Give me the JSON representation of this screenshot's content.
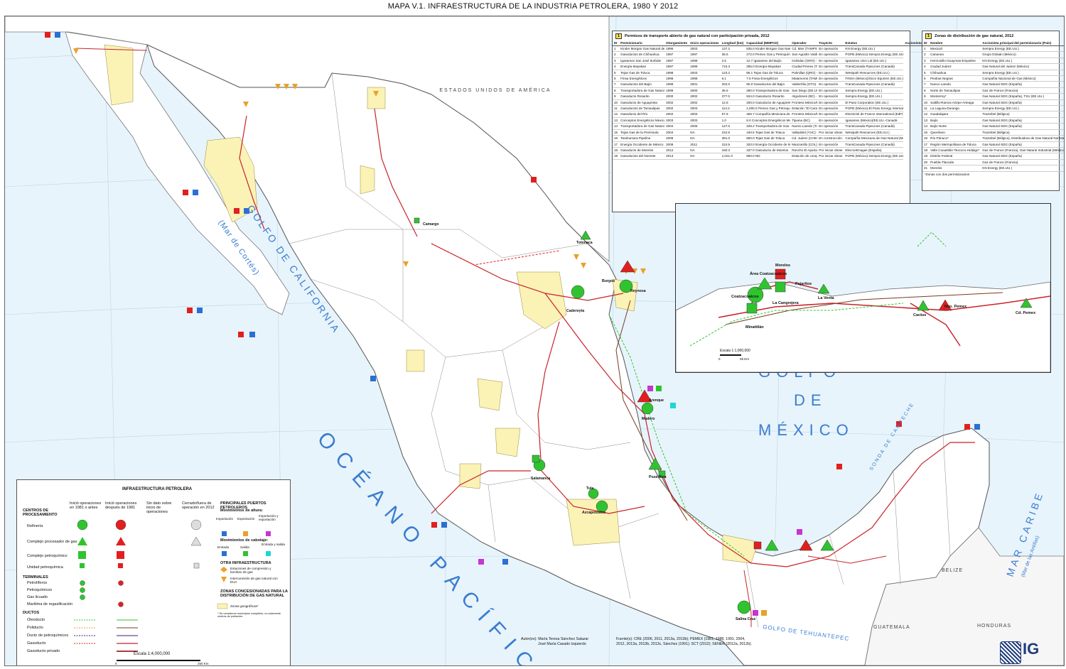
{
  "title": "MAPA V.1. INFRAESTRUCTURA DE LA INDUSTRIA PETROLERA, 1980 Y 2012",
  "labels": {
    "usa": "ESTADOS  UNIDOS  DE  AMÉRICA",
    "golfo_california": "GOLFO DE CALIFORNIA",
    "mar_cortes": "(Mar de Cortés)",
    "golfo_mexico_1": "GOLFO",
    "golfo_mexico_2": "DE",
    "golfo_mexico_3": "MÉXICO",
    "oceano": "OCÉANO PACÍFICO",
    "mar_caribe": "MAR CARIBE",
    "mar_antillas": "(Mar de las Antillas)",
    "belize": "BELIZE",
    "guatemala": "GUATEMALA",
    "honduras": "HONDURAS",
    "tehuantepec": "GOLFO DE TEHUANTEPEC",
    "sonda": "SONDA DE CAMPECHE"
  },
  "cities": [
    {
      "name": "Camargo"
    },
    {
      "name": "Cadereyta"
    },
    {
      "name": "Reynosa"
    },
    {
      "name": "Burgos"
    },
    {
      "name": "Totonaca"
    },
    {
      "name": "Arenque"
    },
    {
      "name": "Madero"
    },
    {
      "name": "Poza Rica"
    },
    {
      "name": "Salamanca"
    },
    {
      "name": "Tula"
    },
    {
      "name": "Azcapotzalco"
    },
    {
      "name": "Salina Cruz"
    }
  ],
  "pipeline_table": {
    "badge": "1",
    "title": "Permisos de transporte abierto de gas natural con participación privada, 2012",
    "headers": [
      "ID",
      "Permisionario",
      "Otorgamiento",
      "Inicio operaciones",
      "Longitud (km)",
      "Capacidad (MMPCD)",
      "Operador",
      "Trayecto",
      "Estatus",
      "Accionista principal (País)"
    ],
    "rows": [
      [
        "1",
        "Kinder Morgan Gas Natural de México",
        "1996",
        "2003",
        "137.2",
        "635.0 Kinder Morgan Gas Natural de México",
        "Cd. Mier (TAMPS) - Monterrey (NL)",
        "En operación",
        "KN Energy (EE.UU.)"
      ],
      [
        "2",
        "Gasoductos de Chihuahua",
        "1997",
        "1997",
        "36.5",
        "272.0 Pemex Gas y Petroquímica Básica",
        "San Agustín Valdivia (Chih) - Samalayuca (Chih)",
        "En operación",
        "PGPB (México)-Sempra Energy (EE.UU.)"
      ],
      [
        "3",
        "Igasamex San José Iturbide",
        "1997",
        "1998",
        "2.5",
        "12.7 Igasamex del Bajío",
        "Irolindan (GRO) - San José Iturbide (GLP)",
        "En operación",
        "Igasamex USA Ltd (EE.UU.)"
      ],
      [
        "4",
        "Energía Mayakan",
        "1997",
        "1999",
        "710.3",
        "285.0 Energía Mayakan",
        "Ciudad Pemex (TAB) - Valladolid (YUC)",
        "En operación",
        "TransCanada PipeLines (Canadá)"
      ],
      [
        "5",
        "Tejas Gas de Toluca",
        "1998",
        "2003",
        "123.2",
        "86.1 Tejas Gas de Toluca",
        "Palmillas (QRO) - Toluca (MEX)",
        "En operación",
        "Westpath Resources (EE.UU.)"
      ],
      [
        "6",
        "Finsa Energéticos",
        "1998",
        "1998",
        "6.1",
        "7.6 Finsa Energéticos",
        "Matamoros (TAMPS)",
        "En operación",
        "FINSA (México)/Sicor EquGen (EE.UU.)"
      ],
      [
        "7",
        "Gasoductos del Bajío",
        "1999",
        "2001",
        "202.0",
        "90.0 Gasoductos del Bajío",
        "Valtierrilla (GTO) - Aguascalientes (AGS)",
        "En operación",
        "TransCanada PipeLines (Canadá)"
      ],
      [
        "8",
        "Transportadora de Gas Natural de Baja California",
        "1999",
        "2000",
        "36.5",
        "280.0 Transportadora de Gas Natural de Baja California",
        "San Diego (EE.UU.) - Rosarito (BC)",
        "En operación",
        "Sempra Energy (EE.UU.)"
      ],
      [
        "9",
        "Gasoducto Rosarito",
        "2000",
        "2002",
        "377.0",
        "534.0 Gasoducto Rosarito",
        "Algodones (BC) - Tijuana (BC)",
        "En operación",
        "Sempra Energy (EE.UU.)"
      ],
      [
        "10",
        "Gasoducto de Aguaprieta",
        "2002",
        "2002",
        "12.5",
        "200.0 Gasoducto de Aguaprieta",
        "Frontera México/Estados Unidos - Naco (SON)",
        "En operación",
        "El Paso Corporation (EE.UU.)"
      ],
      [
        "11",
        "Gasoductos de Tamaulipas",
        "2002",
        "2003",
        "114.2",
        "1,000.0 Pemex Gas y Petroquímica Básica",
        "Estación \"El Caracol\" en Reynosa (TAMPS) - Estación \"Los Indios\" en San Fernando (TAMPS)",
        "En operación",
        "PGPB (México)-El Paso Energy International (EE.UU.)"
      ],
      [
        "12",
        "Gasoducto del Río",
        "2002",
        "2003",
        "57.9",
        "456.7 Compañía Mexicana de Gerencia y Operación",
        "Frontera México/Estados Unidos - CCC Río Bravo II, III y IV y Planta CC (TAMPS)",
        "En operación",
        "Electricité de France International (EdFI) (Francia)"
      ],
      [
        "13",
        "Conceptos Energéticos Mexicanos",
        "2003",
        "2003",
        "1.0",
        "6.0 Conceptos Energéticos Mexicanos",
        "Tijuana (BC)",
        "En operación",
        "Igasamex (México)/EE.UU.-Canadá"
      ],
      [
        "14",
        "Transportadora de Gas Natural de la Huasteca",
        "2004",
        "2006",
        "127.0",
        "349.2 Transportadora de Gas Natural de la Huasteca",
        "Nuevo Laredo (TAMPS) - Tamazunchale (SLP)",
        "En operación",
        "TransCanada PipeLines (Canadá)"
      ],
      [
        "15",
        "Tejas Gas de la Península",
        "2004",
        "NA",
        "234.5",
        "160.5 Tejas Gas de Toluca",
        "Valladolid (YUC) - Nizuc (QROO) y Punta Venado (QROO) y Valladolid (YUC) - Nizuc (QROO)",
        "Por iniciar obras",
        "Westpath Resources (EE.UU.)"
      ],
      [
        "16",
        "Tarahumara Pipeline",
        "2006",
        "NA",
        "381.0",
        "850.0 Tejas Gas de Toluca",
        "Cd. Juárez (CHIH) - Chihuahua (CHIH)",
        "En construcción",
        "Compañía Mexicana de Gas Natural (México)-Energy Transfer Partners (EE.UU.)"
      ],
      [
        "17",
        "Energía Occidente de México",
        "2008",
        "2011",
        "310.5",
        "320.0 Energía Occidente de México",
        "Manzanillo (COL) - Guadalajara (JAL)",
        "En operación",
        "TransCanada PipeLines (Canadá)"
      ],
      [
        "18",
        "Gasoducto de Morelos",
        "2012",
        "NA",
        "160.3",
        "337.0 Gasoducto de Morelos",
        "Rancho El Apartamento en Tlaxco (TLAX) - Huexca (MOR)",
        "Por iniciar obras",
        "ElecnorEnagas (España)"
      ],
      [
        "19",
        "Gasoductos del Noreste",
        "2013",
        "NA",
        "1,021.0",
        "950.0 ND",
        "Estación de compresión Frontera (TAMPS) - Ajalpan El Alto (OTO) - Aguascalientes (AGS)",
        "Por iniciar obras",
        "PGPB (México)-Sempra Energy (EE.UU.)"
      ]
    ]
  },
  "zones_table": {
    "badge": "1",
    "title": "Zonas de distribución de gas natural, 2012",
    "headers": [
      "ID",
      "Nombre",
      "Accionista principal del permisionario (País)"
    ],
    "rows": [
      [
        "1",
        "Mexicali",
        "Sempra Energy (EE.UU.)"
      ],
      [
        "2",
        "Cananea",
        "Grupo Dolaán (México)"
      ],
      [
        "3",
        "Hermosillo-Guaymas-Empalme",
        "KN Energy (EE.UU.)"
      ],
      [
        "4",
        "Ciudad Juárez",
        "Gas Natural del Juárez (México)"
      ],
      [
        "5",
        "Chihuahua",
        "Sempra Energy (EE.UU.)"
      ],
      [
        "6",
        "Piedras Negras",
        "Compañía Nacional de Gas (México)"
      ],
      [
        "7",
        "Nuevo Laredo",
        "Gas Natural SDG (España)"
      ],
      [
        "8",
        "Norte de Tamaulipas",
        "Gaz de France (Francia)"
      ],
      [
        "9",
        "Monterrey*",
        "Gas Natural SDG (España), TXU (EE.UU.)"
      ],
      [
        "10",
        "Saltillo-Ramos Arizpe-Arteaga",
        "Gas Natural SDG (España)"
      ],
      [
        "11",
        "La Laguna-Durango",
        "Sempra Energy (EE.UU.)"
      ],
      [
        "12",
        "Guadalajara",
        "Tractebel (Bélgica)"
      ],
      [
        "13",
        "Bajío",
        "Gas Natural SDG (España)"
      ],
      [
        "14",
        "Bajío Norte",
        "Gas Natural SDG (España)"
      ],
      [
        "15",
        "Querétaro",
        "Tractebel (Bélgica)"
      ],
      [
        "16",
        "Río Pánuco*",
        "Tractebel (Bélgica), Distribuidora de Gas Natural Noreste (México)"
      ],
      [
        "17",
        "Región Metropolitana de Toluca",
        "Gas Natural SDG (España)"
      ],
      [
        "18",
        "Valle Cuautitlán-Texcoco-Hidalgo*",
        "Gaz de France (Francia), Gas Natural Industrial (México)"
      ],
      [
        "19",
        "Distrito Federal",
        "Gas Natural SDG (España)"
      ],
      [
        "20",
        "Puebla-Tlaxcala",
        "Gaz de France (Francia)"
      ],
      [
        "21",
        "Morelos",
        "KN Energy (EE.UU.)"
      ]
    ],
    "note": "*Zonas con dos permisionarios"
  },
  "legend": {
    "title": "INFRAESTRUCTURA PETROLERA",
    "cols": [
      "Inició operaciones en 1981 o antes",
      "Inició operaciones después de 1981",
      "Sin dato sobre inicio de operaciones",
      "Cerrado/fuera de operación en 2012"
    ],
    "processing_title": "CENTROS DE PROCESAMIENTO",
    "processing": [
      "Refinería",
      "Complejo procesador de gas",
      "Complejo petroquímico",
      "Unidad petroquímica"
    ],
    "terminals_title": "TERMINALES",
    "terminals": [
      "Petrolíferos",
      "Petroquímicos",
      "Gas licuado",
      "Marítima de regasificación"
    ],
    "ducts_title": "DUCTOS",
    "ducts": [
      "Oleoducto",
      "Poliducto",
      "Ducto de petroquímicos",
      "Gasoducto",
      "Gasoducto privado"
    ],
    "ports_title": "PRINCIPALES PUERTOS PETROLEROS",
    "altura_title": "Movimientos de altura:",
    "altura": [
      "Importación",
      "Exportación",
      "Importación y exportación"
    ],
    "cabotaje_title": "Movimientos de cabotaje:",
    "cabotaje": [
      "Entrada",
      "Salida",
      "Entrada y salida"
    ],
    "other_title": "OTRA INFRAESTRUCTURA",
    "other": [
      "Estaciones de compresión y bombeo de gas",
      "Interconexión de gas natural con EUA"
    ],
    "zones_title": "ZONAS CONCESIONADAS PARA LA DISTRIBUCIÓN DE GAS NATURAL",
    "zones": "Zonas geográficas*",
    "zones_note": "* Se consideran municipios completos, no solamente centros de población.",
    "scale": "Escala 1:4,000,000",
    "scale_0": "0",
    "scale_250": "250 Km"
  },
  "inset": {
    "labels": [
      "Área Coatzacoalcos",
      "Coatzacoalcos",
      "Minatitlán",
      "La Cangrejera",
      "Morelos",
      "Pajaritos",
      "La Venta",
      "Cactus",
      "Nvo. Pemex",
      "Cd. Pemex"
    ],
    "scale": "Escala 1:1,000,000",
    "scale_0": "0",
    "scale_25": "25 Km"
  },
  "credits": {
    "authors_label": "Autor(es):",
    "authors": [
      "María Teresa Sánchez Salazar",
      "José María Casado Izquierdo"
    ],
    "sources": [
      "Fuente(s): CRE (2006, 2011, 2013a, 2013b); PEMEX (1981, 1988, 1991, 2004,",
      "2012, 2013a, 2013b, 2013c, Sánchez (1991); SCT (2012); SENER (2012a, 2012b)."
    ],
    "ig": "IG"
  },
  "colors": {
    "sea": "#e8f4fb",
    "land": "#ffffff",
    "zone": "#fbf2b6",
    "green": "#2fc42f",
    "red": "#e21f1f",
    "ocean_text": "#3a7dd1",
    "gas_pipe": "#c8242b",
    "oil_pipe": "#7a3b1e"
  }
}
